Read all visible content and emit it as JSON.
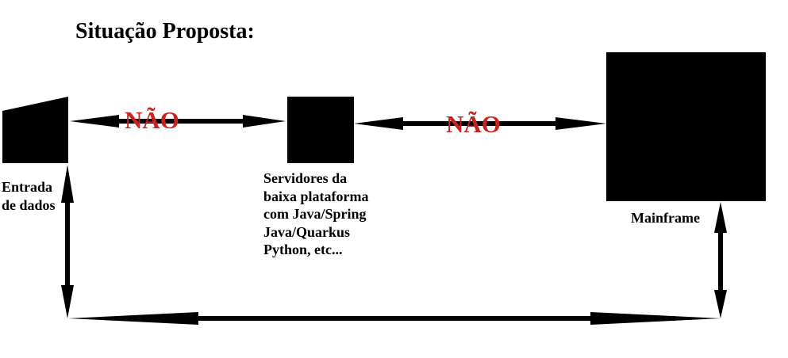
{
  "title": "Situação Proposta:",
  "nodes": {
    "input": {
      "label": "Entrada\nde dados"
    },
    "servers": {
      "label": "Servidores da\nbaixa plataforma\ncom Java/Spring\nJava/Quarkus\nPython, etc..."
    },
    "mainframe": {
      "label": "Mainframe"
    }
  },
  "connections": {
    "input_servers": {
      "label": "NÃO",
      "allowed": false
    },
    "servers_mainframe": {
      "label": "NÃO",
      "allowed": false
    },
    "input_mainframe": {
      "allowed": true
    }
  },
  "colors": {
    "shape": "#000000",
    "deny_text": "#c8241f"
  }
}
